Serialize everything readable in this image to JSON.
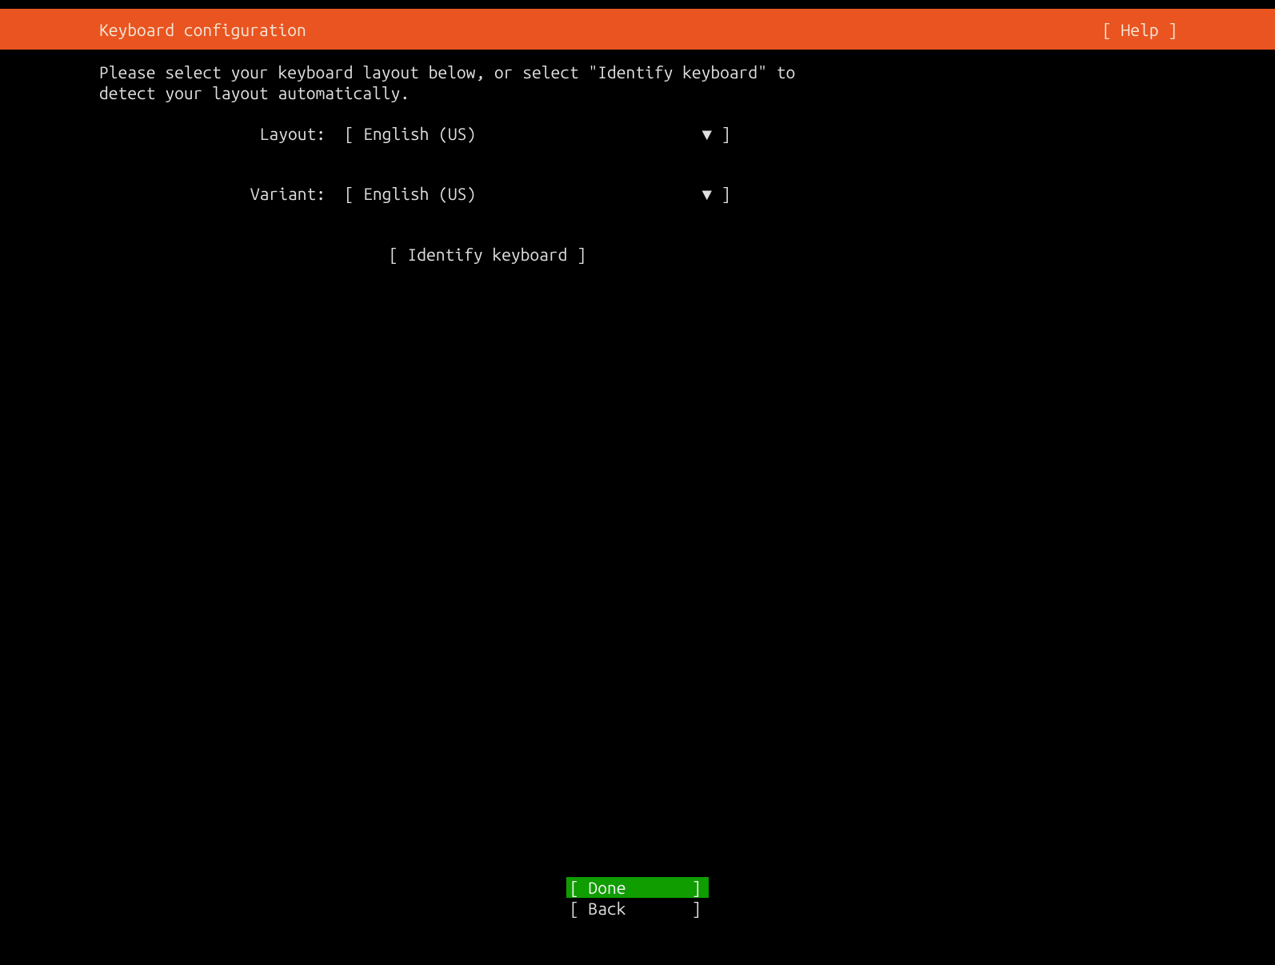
{
  "header": {
    "title": "Keyboard configuration",
    "help_label": "[ Help ]"
  },
  "instruction": "Please select your keyboard layout below, or select \"Identify keyboard\" to\ndetect your layout automatically.",
  "fields": {
    "layout": {
      "label": "Layout:",
      "value": "English (US)"
    },
    "variant": {
      "label": "Variant:",
      "value": "English (US)"
    }
  },
  "identify_label": "[ Identify keyboard ]",
  "dropdown_arrow": "▼",
  "footer": {
    "done_label": "[ Done       ]",
    "back_label": "[ Back       ]"
  }
}
